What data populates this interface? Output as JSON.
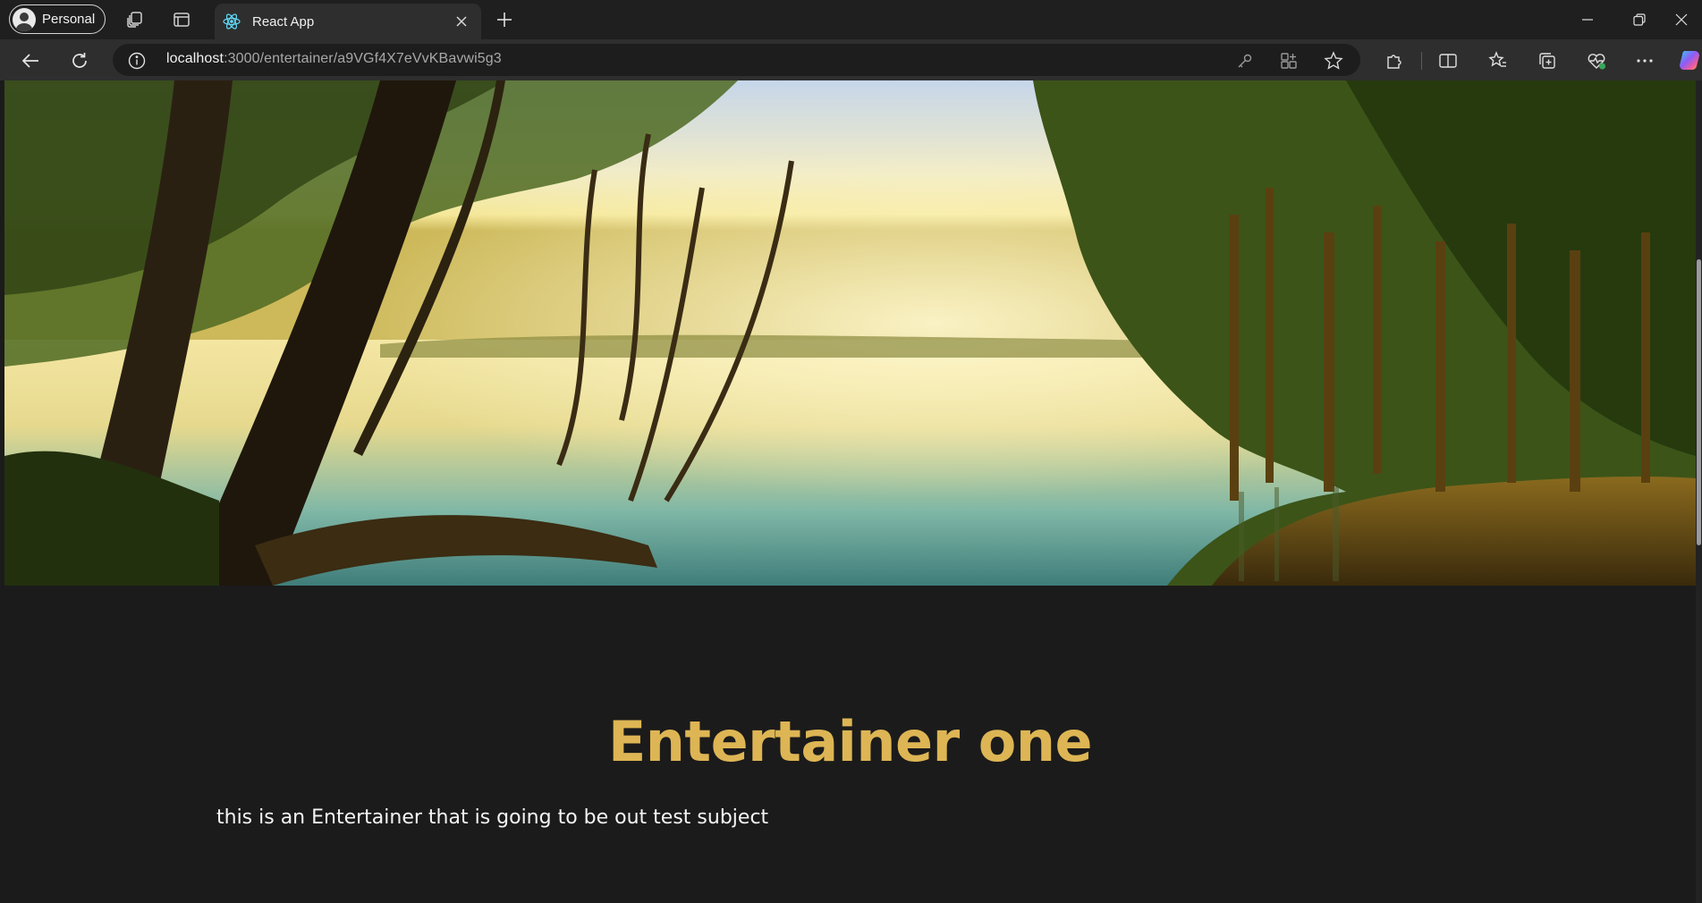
{
  "browser": {
    "profile_label": "Personal",
    "tab": {
      "title": "React App"
    },
    "address": {
      "host": "localhost",
      "path": ":3000/entertainer/a9VGf4X7eVvKBavwi5g3"
    }
  },
  "icons": {
    "profile": "avatar-icon",
    "workspaces": "workspaces-icon",
    "tab_actions": "tab-actions-icon",
    "favicon": "react-logo-icon",
    "tab_close": "close-icon",
    "new_tab": "plus-icon",
    "minimize": "minimize-icon",
    "restore": "restore-icon",
    "window_close": "close-icon",
    "back": "back-arrow-icon",
    "refresh": "refresh-icon",
    "site_info": "info-icon",
    "password": "key-icon",
    "app_available": "app-grid-icon",
    "favorite": "star-icon",
    "extensions": "puzzle-icon",
    "split_screen": "split-screen-icon",
    "favorites": "favorites-list-icon",
    "collections": "collections-icon",
    "browser_essentials": "heart-pulse-icon",
    "more": "more-icon",
    "copilot": "copilot-icon"
  },
  "colors": {
    "page_background": "#1b1b1b",
    "heading": "#ddb554",
    "body_text": "#f4f4f4",
    "tab_active": "#2e2e2e",
    "tabstrip": "#1f1f1f"
  },
  "content": {
    "hero_image": "lake-landscape-image",
    "title": "Entertainer one",
    "description": "this is an Entertainer that is going to be out test subject"
  }
}
